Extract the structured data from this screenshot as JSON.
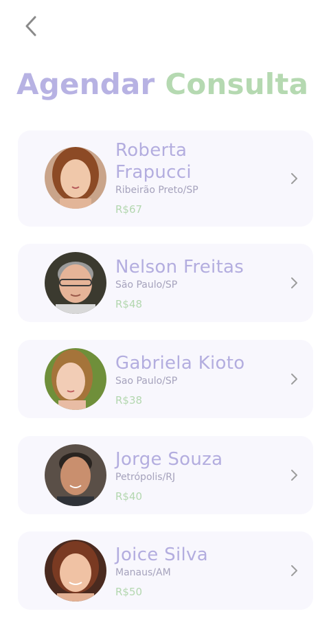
{
  "header": {
    "back_icon": "chevron-left-icon",
    "title_part1": "Agendar",
    "title_part2": "Consulta",
    "title_color1": "#b7b2e3",
    "title_color2": "#b5d9b1"
  },
  "doctors": [
    {
      "name_line1": "Roberta",
      "name_line2": "Frapucci",
      "location": "Ribeirão Preto/SP",
      "price": "R$67"
    },
    {
      "name": "Nelson Freitas",
      "location": "São Paulo/SP",
      "price": "R$48"
    },
    {
      "name": "Gabriela Kioto",
      "location": "Sao Paulo/SP",
      "price": "R$38"
    },
    {
      "name": "Jorge Souza",
      "location": "Petrópolis/RJ",
      "price": "R$40"
    },
    {
      "name": "Joice Silva",
      "location": "Manaus/AM",
      "price": "R$50"
    }
  ],
  "icons": {
    "row_action": "chevron-right-icon",
    "avatar": "doctor-photo"
  }
}
